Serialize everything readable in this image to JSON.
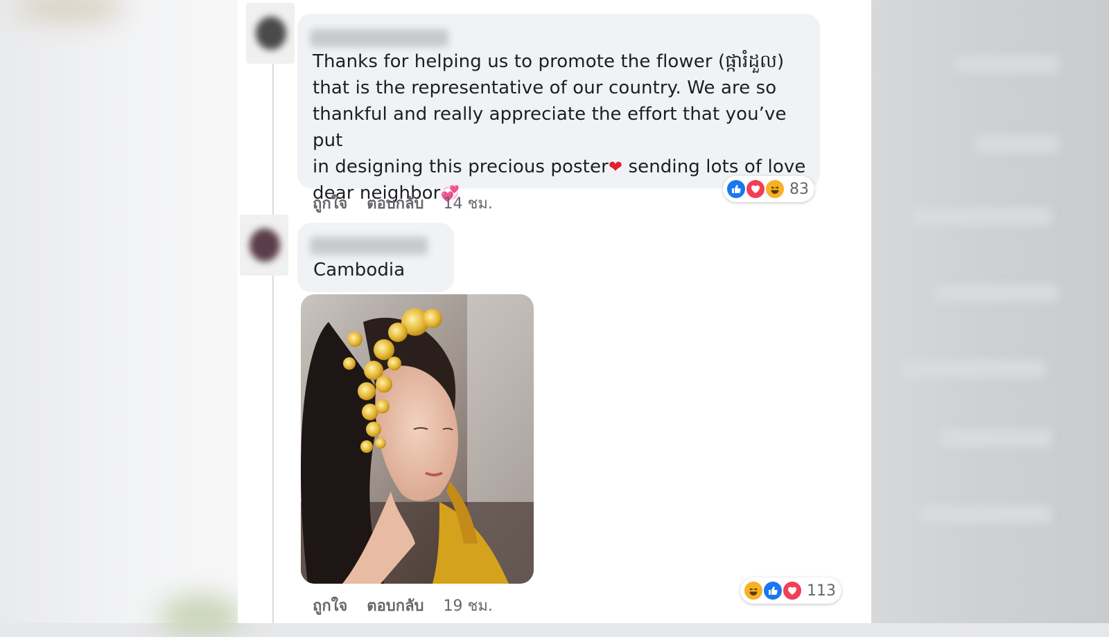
{
  "comments": [
    {
      "text_main": "Thanks for helping us to promote the flower (ផ្ការំដួល)\nthat is the representative of our country. We are so\nthankful and really appreciate the effort that you’ve put\nin designing this precious poster",
      "text_heart": "❤",
      "text_after_heart": " sending lots of love\ndear neighbor",
      "text_end_emoji": "💞",
      "actions": {
        "like": "ถูกใจ",
        "reply": "ตอบกลับ",
        "time": "14 ชม."
      },
      "reactions": {
        "icons": [
          "like-icon",
          "love-icon",
          "haha-icon"
        ],
        "count": "83"
      }
    },
    {
      "text": "Cambodia",
      "flag": "cambodia-flag-icon",
      "actions": {
        "like": "ถูกใจ",
        "reply": "ตอบกลับ",
        "time": "19 ชม."
      },
      "reactions": {
        "icons": [
          "haha-icon",
          "like-icon",
          "love-icon"
        ],
        "count": "113"
      }
    }
  ],
  "colors": {
    "bubble": "#f0f2f5",
    "meta_text": "#65676b",
    "like": "#1877f2",
    "love": "#f33e58",
    "haha": "#f7b125"
  }
}
